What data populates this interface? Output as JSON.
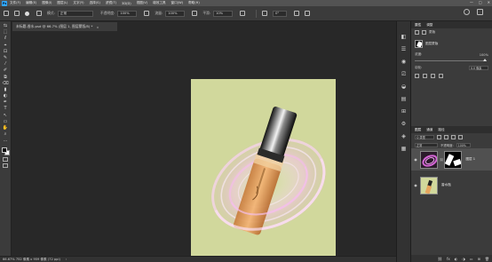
{
  "app": {
    "logo": "Ps"
  },
  "menu": [
    "文件(F)",
    "编辑(E)",
    "图像(I)",
    "图层(L)",
    "文字(Y)",
    "选择(S)",
    "滤镜(T)",
    "3D(D)",
    "视图(V)",
    "增效工具",
    "窗口(W)",
    "帮助(H)"
  ],
  "window_controls": [
    "—",
    "□",
    "✕"
  ],
  "options": {
    "mode_label": "模式:",
    "mode_value": "正常",
    "opacity_label": "不透明度:",
    "opacity_value": "100%",
    "flow_label": "流量:",
    "flow_value": "100%",
    "smooth_label": "平滑:",
    "smooth_value": "10%",
    "angle_value": "0°"
  },
  "document_tab": {
    "title": "未标题-香水.psd @ 66.7% (图层 1, 图层蒙版/8) *",
    "close": "×"
  },
  "status": {
    "text": "66.67%  752 像素 x 959 像素 (72 ppi)",
    "arrow": "›"
  },
  "toolbar": {
    "tools": [
      "⇆",
      "⬚",
      "ℓ",
      "⌖",
      "⊡",
      "✎",
      "⁄",
      "✐",
      "⧉",
      "⌫",
      "▮",
      "◐",
      "✒",
      "T",
      "↖",
      "▭",
      "✋",
      "⌕",
      "…"
    ]
  },
  "icon_strip": [
    "◧",
    "☰",
    "◉",
    "⎚",
    "◒",
    "▤",
    "⊞",
    "⚙",
    "◈",
    "▦"
  ],
  "properties": {
    "tabs": [
      "属性",
      "调整"
    ],
    "type_label": "蒙版",
    "mask_label": "图层蒙版",
    "density_label": "浓度:",
    "density_value": "100%",
    "feather_label": "羽化:",
    "feather_value": "0.0 像素"
  },
  "layers": {
    "tabs": [
      "图层",
      "通道",
      "路径"
    ],
    "kind_label": "Q 类型",
    "blend_mode": "正常",
    "opacity_label": "不透明度:",
    "opacity_value": "100%",
    "lock_label": "锁定:",
    "fill_label": "填充:",
    "fill_value": "100%",
    "items": [
      {
        "name": "图层 1",
        "visible": true
      },
      {
        "name": "香水瓶",
        "visible": true
      }
    ],
    "footer_icons": [
      "⛓",
      "fx",
      "◐",
      "◑",
      "▭",
      "⊞",
      "🗑"
    ]
  }
}
